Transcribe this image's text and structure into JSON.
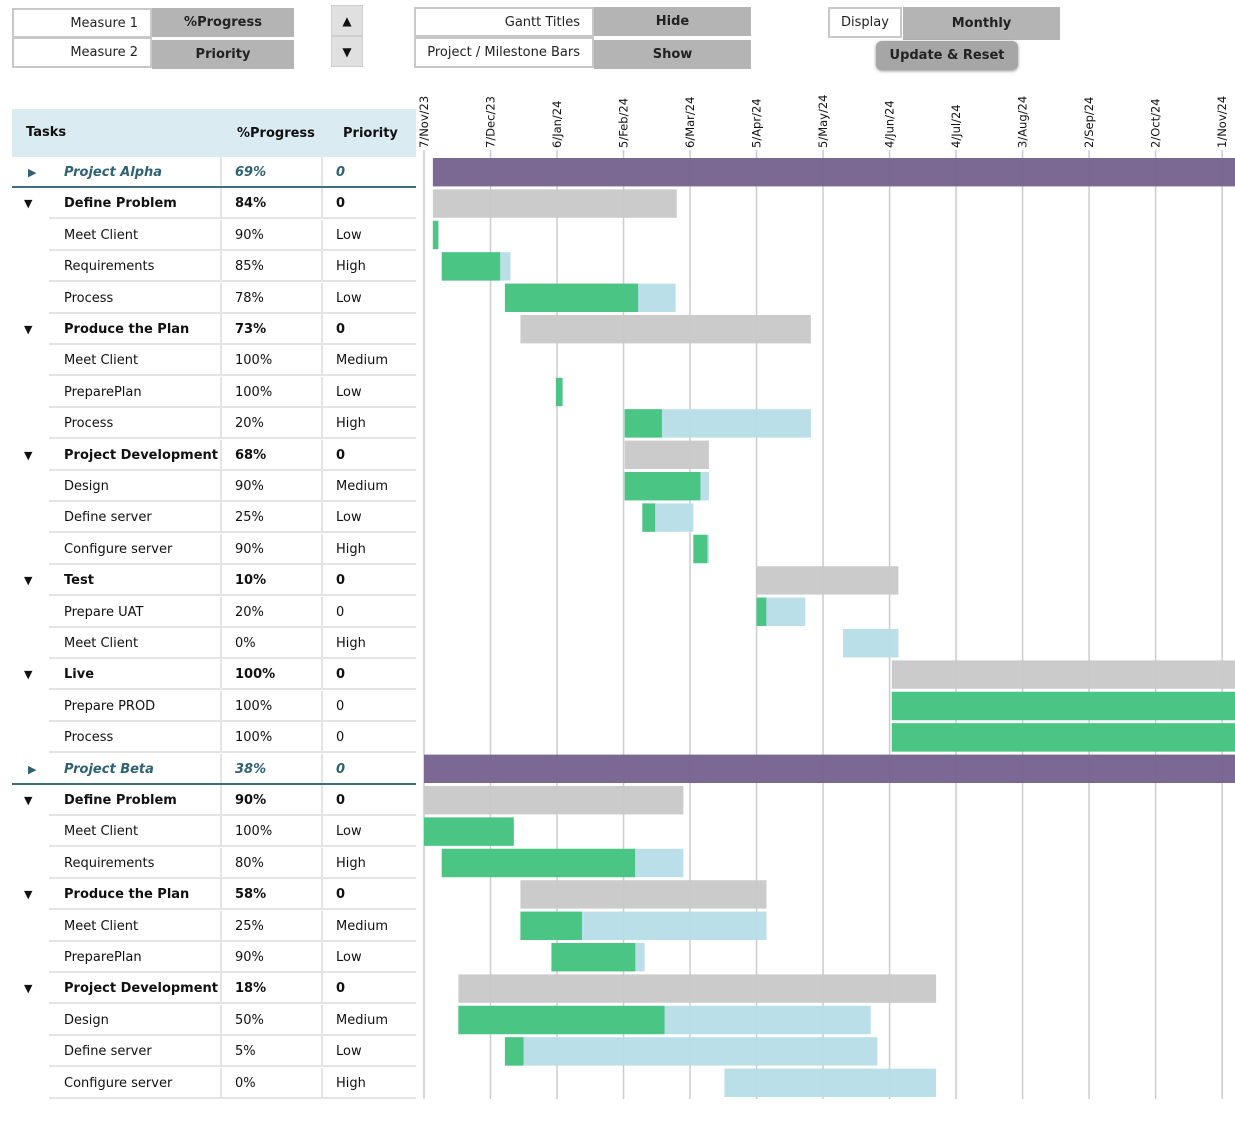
{
  "controls": {
    "measure1_label": "Measure 1",
    "measure1_value": "%Progress",
    "measure2_label": "Measure 2",
    "measure2_value": "Priority",
    "spin_up_icon": "triangle-up-icon",
    "spin_down_icon": "triangle-down-icon",
    "gantt_titles_label": "Gantt Titles",
    "gantt_titles_value": "Hide",
    "bars_label": "Project / Milestone Bars",
    "bars_value": "Show",
    "display_label": "Display",
    "display_value": "Monthly",
    "update_button": "Update & Reset"
  },
  "table": {
    "headers": {
      "tasks": "Tasks",
      "progress": "%Progress",
      "priority": "Priority"
    }
  },
  "colors": {
    "project_bar": "#77638f",
    "group_bar": "#c8c8c8",
    "done": "#46c480",
    "remaining": "#b6dde8",
    "header_bg": "#daebf1",
    "project_text": "#2e6272",
    "gridline": "#cccccc"
  },
  "chart_data": {
    "type": "gantt",
    "title": "",
    "axis_origin": "7/Nov/23",
    "x_unit": "days since 7/Nov/23",
    "xlim": [
      0,
      366
    ],
    "ticks": [
      {
        "label": "7/Nov/23",
        "day": 0
      },
      {
        "label": "7/Dec/23",
        "day": 30
      },
      {
        "label": "6/Jan/24",
        "day": 60
      },
      {
        "label": "5/Feb/24",
        "day": 90
      },
      {
        "label": "6/Mar/24",
        "day": 120
      },
      {
        "label": "5/Apr/24",
        "day": 150
      },
      {
        "label": "5/May/24",
        "day": 180
      },
      {
        "label": "4/Jun/24",
        "day": 210
      },
      {
        "label": "4/Jul/24",
        "day": 240
      },
      {
        "label": "3/Aug/24",
        "day": 270
      },
      {
        "label": "2/Sep/24",
        "day": 300
      },
      {
        "label": "2/Oct/24",
        "day": 330
      },
      {
        "label": "1/Nov/24",
        "day": 360
      }
    ],
    "grid": true,
    "rows": [
      {
        "level": "project",
        "task": "Project Alpha",
        "progress": "69%",
        "priority": "0",
        "start": 4,
        "end": 400,
        "pct": null
      },
      {
        "level": "group",
        "task": "Define Problem",
        "progress": "84%",
        "priority": "0",
        "start": 4,
        "end": 114,
        "pct": null
      },
      {
        "level": "task",
        "task": "Meet Client",
        "progress": "90%",
        "priority": "Low",
        "start": 4,
        "end": 6.5,
        "pct": 1.0
      },
      {
        "level": "task",
        "task": "Requirements",
        "progress": "85%",
        "priority": "High",
        "start": 8,
        "end": 39,
        "pct": 0.85
      },
      {
        "level": "task",
        "task": "Process",
        "progress": "78%",
        "priority": "Low",
        "start": 36.5,
        "end": 113.5,
        "pct": 0.78
      },
      {
        "level": "group",
        "task": "Produce the Plan",
        "progress": "73%",
        "priority": "0",
        "start": 43.5,
        "end": 174.5,
        "pct": null
      },
      {
        "level": "task",
        "task": "Meet Client",
        "progress": "100%",
        "priority": "Medium",
        "start": null,
        "end": null,
        "pct": 1.0
      },
      {
        "level": "task",
        "task": "PreparePlan",
        "progress": "100%",
        "priority": "Low",
        "start": 59.5,
        "end": 62.5,
        "pct": 1.0
      },
      {
        "level": "task",
        "task": "Process",
        "progress": "20%",
        "priority": "High",
        "start": 90.5,
        "end": 174.5,
        "pct": 0.2
      },
      {
        "level": "group",
        "task": "Project Development",
        "progress": "68%",
        "priority": "0",
        "start": 90.5,
        "end": 128.5,
        "pct": null
      },
      {
        "level": "task",
        "task": "Design",
        "progress": "90%",
        "priority": "Medium",
        "start": 90.5,
        "end": 128.5,
        "pct": 0.9
      },
      {
        "level": "task",
        "task": "Define server",
        "progress": "25%",
        "priority": "Low",
        "start": 98.5,
        "end": 121.5,
        "pct": 0.25
      },
      {
        "level": "task",
        "task": "Configure server",
        "progress": "90%",
        "priority": "High",
        "start": 121.5,
        "end": 128.5,
        "pct": 0.9
      },
      {
        "level": "group",
        "task": "Test",
        "progress": "10%",
        "priority": "0",
        "start": 150,
        "end": 214,
        "pct": null
      },
      {
        "level": "task",
        "task": "Prepare UAT",
        "progress": "20%",
        "priority": "0",
        "start": 150,
        "end": 172,
        "pct": 0.2
      },
      {
        "level": "task",
        "task": "Meet Client",
        "progress": "0%",
        "priority": "High",
        "start": 189,
        "end": 214,
        "pct": 0
      },
      {
        "level": "group",
        "task": "Live",
        "progress": "100%",
        "priority": "0",
        "start": 211,
        "end": 400,
        "pct": null
      },
      {
        "level": "task",
        "task": "Prepare PROD",
        "progress": "100%",
        "priority": "0",
        "start": 211,
        "end": 400,
        "pct": 1.0
      },
      {
        "level": "task",
        "task": "Process",
        "progress": "100%",
        "priority": "0",
        "start": 211,
        "end": 400,
        "pct": 1.0
      },
      {
        "level": "project",
        "task": "Project Beta",
        "progress": "38%",
        "priority": "0",
        "start": 0,
        "end": 400,
        "pct": null
      },
      {
        "level": "group",
        "task": "Define Problem",
        "progress": "90%",
        "priority": "0",
        "start": 0,
        "end": 117,
        "pct": null
      },
      {
        "level": "task",
        "task": "Meet Client",
        "progress": "100%",
        "priority": "Low",
        "start": 0,
        "end": 40.5,
        "pct": 1.0
      },
      {
        "level": "task",
        "task": "Requirements",
        "progress": "80%",
        "priority": "High",
        "start": 8,
        "end": 117,
        "pct": 0.8
      },
      {
        "level": "group",
        "task": "Produce the Plan",
        "progress": "58%",
        "priority": "0",
        "start": 43.5,
        "end": 154.5,
        "pct": null
      },
      {
        "level": "task",
        "task": "Meet Client",
        "progress": "25%",
        "priority": "Medium",
        "start": 43.5,
        "end": 154.5,
        "pct": 0.25
      },
      {
        "level": "task",
        "task": "PreparePlan",
        "progress": "90%",
        "priority": "Low",
        "start": 57.5,
        "end": 99.5,
        "pct": 0.9
      },
      {
        "level": "group",
        "task": "Project Development",
        "progress": "18%",
        "priority": "0",
        "start": 15.5,
        "end": 231,
        "pct": null
      },
      {
        "level": "task",
        "task": "Design",
        "progress": "50%",
        "priority": "Medium",
        "start": 15.5,
        "end": 201.5,
        "pct": 0.5
      },
      {
        "level": "task",
        "task": "Define server",
        "progress": "5%",
        "priority": "Low",
        "start": 36.5,
        "end": 204.5,
        "pct": 0.05
      },
      {
        "level": "task",
        "task": "Configure server",
        "progress": "0%",
        "priority": "High",
        "start": 135.5,
        "end": 231,
        "pct": 0
      }
    ]
  }
}
